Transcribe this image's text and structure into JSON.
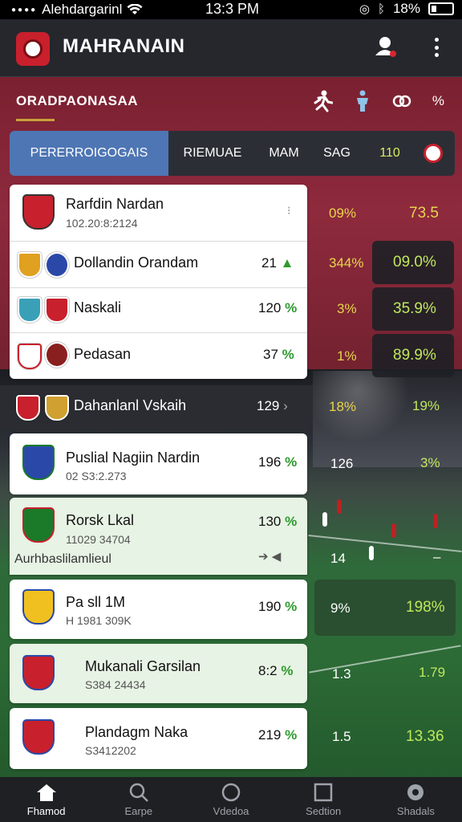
{
  "status_bar": {
    "carrier": "Alehdargarinl",
    "time": "13:3 PM",
    "battery": "18%"
  },
  "app_bar": {
    "title": "MAHRANAIN",
    "icons": [
      "shield-logo-icon",
      "profile-icon",
      "more-vert-icon"
    ]
  },
  "section": {
    "title": "ORADPAONASAA",
    "icon_right_text": "%"
  },
  "tabs": [
    {
      "label": "PERERROIGOGAIS",
      "active": true
    },
    {
      "label": "RIEMUAE",
      "active": false
    },
    {
      "label": "MAM",
      "active": false
    },
    {
      "label": "SAG",
      "active": false
    },
    {
      "label": "110",
      "active": false
    }
  ],
  "group1": {
    "header": {
      "name": "Rarfdin Nardan",
      "sub": "102.20:8:2124"
    },
    "rows": [
      {
        "name": "Dollandin Orandam",
        "value": "21",
        "trend": "▲"
      },
      {
        "name": "Naskali",
        "value": "120",
        "pct": "%"
      },
      {
        "name": "Pedasan",
        "value": "37",
        "pct": "%"
      }
    ]
  },
  "right_stats": [
    {
      "left": "09%",
      "right": "73.5"
    },
    {
      "left": "344%",
      "right": "09.0%"
    },
    {
      "left": "3%",
      "right": "35.9%"
    },
    {
      "left": "1%",
      "right": "89.9%"
    },
    {
      "left": "18%",
      "right": "19%"
    },
    {
      "left": "126",
      "right": "3%"
    },
    {
      "left": "14",
      "right": "–"
    },
    {
      "left": "9%",
      "right": "198%"
    },
    {
      "left": "1.3",
      "right": "1.79"
    },
    {
      "left": "1.5",
      "right": "13.36"
    }
  ],
  "band": {
    "name": "Dahanlanl Vskaih",
    "value": "129",
    "chevron": "›"
  },
  "group2": [
    {
      "name": "Puslial Nagiin Nardin",
      "sub": "02 S3:2.273",
      "value": "196",
      "pct": "%"
    },
    {
      "name": "Rorsk Lkal",
      "sub": "11029 34704",
      "value": "130",
      "pct": "%"
    },
    {
      "name": "Pa sll 1M",
      "sub": "H 1981 309K",
      "value": "190",
      "pct": "%"
    },
    {
      "name": "Mukanali Garsilan",
      "sub": "S384 24434",
      "value": "8:2",
      "pct": "%"
    },
    {
      "name": "Plandagm Naka",
      "sub": "S3412202",
      "value": "219",
      "pct": "%"
    }
  ],
  "sub_label": "Aurhbaslilamlieul",
  "bottom_nav": [
    {
      "label": "Fhamod",
      "icon": "home-icon",
      "active": true
    },
    {
      "label": "Earpe",
      "icon": "search-icon",
      "active": false
    },
    {
      "label": "Vdedoa",
      "icon": "circle-icon",
      "active": false
    },
    {
      "label": "Sedtion",
      "icon": "square-icon",
      "active": false
    },
    {
      "label": "Shadals",
      "icon": "ball-icon",
      "active": false
    }
  ],
  "colors": {
    "accent_blue": "#4e76b4",
    "header_red": "#8e2a3d",
    "positive_green": "#2f9a2f",
    "stat_yellow": "#e7d54c"
  }
}
